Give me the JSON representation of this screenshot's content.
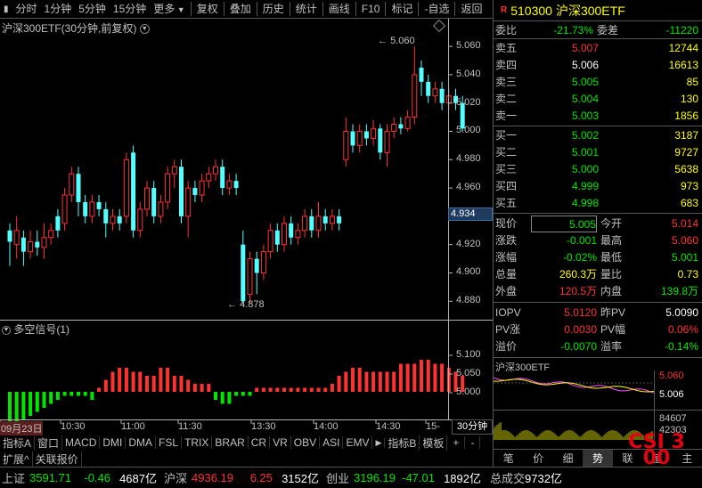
{
  "toolbar": {
    "items": [
      "分时",
      "1分钟",
      "5分钟",
      "15分钟",
      "更多",
      "复权",
      "叠加",
      "历史",
      "统计",
      "画线",
      "F10",
      "标记",
      "-自选",
      "返回"
    ]
  },
  "chart": {
    "title": "沪深300ETF(30分钟,前复权)",
    "current_price_tag": "4.934",
    "high_label": "5.060",
    "low_label": "4.878",
    "yticks": [
      "5.060",
      "5.040",
      "5.020",
      "5.000",
      "4.980",
      "4.960",
      "4.940",
      "4.920",
      "4.900",
      "4.880"
    ],
    "xticks": [
      "09月23日",
      "10:30",
      "11:00",
      "11:30",
      "13:30",
      "14:00",
      "14:30",
      "15-"
    ]
  },
  "indicator": {
    "title": "多空信号(1)",
    "yticks": [
      "5.100",
      "5.050",
      "5.000"
    ]
  },
  "chart_data": {
    "type": "candlestick",
    "candles": [
      {
        "o": 4.93,
        "c": 4.922,
        "h": 4.935,
        "l": 4.905
      },
      {
        "o": 4.92,
        "c": 4.93,
        "h": 4.94,
        "l": 4.91
      },
      {
        "o": 4.925,
        "c": 4.915,
        "h": 4.93,
        "l": 4.905
      },
      {
        "o": 4.915,
        "c": 4.922,
        "h": 4.93,
        "l": 4.91
      },
      {
        "o": 4.922,
        "c": 4.918,
        "h": 4.93,
        "l": 4.912
      },
      {
        "o": 4.918,
        "c": 4.925,
        "h": 4.935,
        "l": 4.91
      },
      {
        "o": 4.925,
        "c": 4.93,
        "h": 4.935,
        "l": 4.92
      },
      {
        "o": 4.94,
        "c": 4.93,
        "h": 4.945,
        "l": 4.925
      },
      {
        "o": 4.935,
        "c": 4.955,
        "h": 4.96,
        "l": 4.93
      },
      {
        "o": 4.955,
        "c": 4.97,
        "h": 4.975,
        "l": 4.95
      },
      {
        "o": 4.97,
        "c": 4.95,
        "h": 4.975,
        "l": 4.94
      },
      {
        "o": 4.95,
        "c": 4.94,
        "h": 4.955,
        "l": 4.935
      },
      {
        "o": 4.94,
        "c": 4.95,
        "h": 4.955,
        "l": 4.935
      },
      {
        "o": 4.95,
        "c": 4.945,
        "h": 4.955,
        "l": 4.94
      },
      {
        "o": 4.945,
        "c": 4.935,
        "h": 4.95,
        "l": 4.925
      },
      {
        "o": 4.935,
        "c": 4.94,
        "h": 4.945,
        "l": 4.93
      },
      {
        "o": 4.94,
        "c": 4.935,
        "h": 4.945,
        "l": 4.93
      },
      {
        "o": 4.94,
        "c": 4.98,
        "h": 4.985,
        "l": 4.935
      },
      {
        "o": 4.985,
        "c": 4.93,
        "h": 4.99,
        "l": 4.925
      },
      {
        "o": 4.93,
        "c": 4.945,
        "h": 4.95,
        "l": 4.925
      },
      {
        "o": 4.945,
        "c": 4.96,
        "h": 4.965,
        "l": 4.94
      },
      {
        "o": 4.96,
        "c": 4.94,
        "h": 4.965,
        "l": 4.935
      },
      {
        "o": 4.94,
        "c": 4.95,
        "h": 4.955,
        "l": 4.935
      },
      {
        "o": 4.95,
        "c": 4.97,
        "h": 4.975,
        "l": 4.945
      },
      {
        "o": 4.97,
        "c": 4.975,
        "h": 4.98,
        "l": 4.96
      },
      {
        "o": 4.975,
        "c": 4.94,
        "h": 4.98,
        "l": 4.935
      },
      {
        "o": 4.94,
        "c": 4.96,
        "h": 4.965,
        "l": 4.925
      },
      {
        "o": 4.96,
        "c": 4.955,
        "h": 4.965,
        "l": 4.95
      },
      {
        "o": 4.955,
        "c": 4.965,
        "h": 4.97,
        "l": 4.95
      },
      {
        "o": 4.965,
        "c": 4.97,
        "h": 4.975,
        "l": 4.96
      },
      {
        "o": 4.97,
        "c": 4.975,
        "h": 4.98,
        "l": 4.965
      },
      {
        "o": 4.975,
        "c": 4.96,
        "h": 4.98,
        "l": 4.955
      },
      {
        "o": 4.96,
        "c": 4.965,
        "h": 4.97,
        "l": 4.955
      },
      {
        "o": 4.965,
        "c": 4.96,
        "h": 4.97,
        "l": 4.955
      },
      {
        "o": 4.92,
        "c": 4.88,
        "h": 4.93,
        "l": 4.878
      },
      {
        "o": 4.885,
        "c": 4.91,
        "h": 4.915,
        "l": 4.878
      },
      {
        "o": 4.91,
        "c": 4.9,
        "h": 4.915,
        "l": 4.885
      },
      {
        "o": 4.9,
        "c": 4.915,
        "h": 4.92,
        "l": 4.895
      },
      {
        "o": 4.915,
        "c": 4.93,
        "h": 4.935,
        "l": 4.91
      },
      {
        "o": 4.93,
        "c": 4.92,
        "h": 4.935,
        "l": 4.915
      },
      {
        "o": 4.92,
        "c": 4.935,
        "h": 4.94,
        "l": 4.915
      },
      {
        "o": 4.935,
        "c": 4.925,
        "h": 4.94,
        "l": 4.92
      },
      {
        "o": 4.925,
        "c": 4.93,
        "h": 4.935,
        "l": 4.92
      },
      {
        "o": 4.93,
        "c": 4.94,
        "h": 4.945,
        "l": 4.925
      },
      {
        "o": 4.94,
        "c": 4.93,
        "h": 4.945,
        "l": 4.925
      },
      {
        "o": 4.93,
        "c": 4.94,
        "h": 4.95,
        "l": 4.925
      },
      {
        "o": 4.94,
        "c": 4.935,
        "h": 4.945,
        "l": 4.93
      },
      {
        "o": 4.935,
        "c": 4.94,
        "h": 4.945,
        "l": 4.93
      },
      {
        "o": 4.94,
        "c": 4.935,
        "h": 4.945,
        "l": 4.93
      },
      {
        "o": 4.98,
        "c": 5.0,
        "h": 5.01,
        "l": 4.975
      },
      {
        "o": 5.0,
        "c": 4.99,
        "h": 5.005,
        "l": 4.985
      },
      {
        "o": 4.99,
        "c": 5.0,
        "h": 5.005,
        "l": 4.985
      },
      {
        "o": 5.0,
        "c": 4.995,
        "h": 5.005,
        "l": 4.99
      },
      {
        "o": 4.995,
        "c": 5.002,
        "h": 5.008,
        "l": 4.99
      },
      {
        "o": 5.002,
        "c": 4.985,
        "h": 5.005,
        "l": 4.98
      },
      {
        "o": 4.985,
        "c": 5.0,
        "h": 5.005,
        "l": 4.975
      },
      {
        "o": 5.0,
        "c": 5.005,
        "h": 5.01,
        "l": 4.995
      },
      {
        "o": 5.005,
        "c": 5.002,
        "h": 5.01,
        "l": 4.998
      },
      {
        "o": 5.002,
        "c": 5.01,
        "h": 5.015,
        "l": 5.0
      },
      {
        "o": 5.01,
        "c": 5.04,
        "h": 5.06,
        "l": 5.005
      },
      {
        "o": 5.045,
        "c": 5.035,
        "h": 5.05,
        "l": 5.025
      },
      {
        "o": 5.035,
        "c": 5.025,
        "h": 5.04,
        "l": 5.02
      },
      {
        "o": 5.025,
        "c": 5.03,
        "h": 5.035,
        "l": 5.02
      },
      {
        "o": 5.03,
        "c": 5.02,
        "h": 5.035,
        "l": 5.015
      },
      {
        "o": 5.02,
        "c": 5.025,
        "h": 5.03,
        "l": 5.015
      },
      {
        "o": 5.025,
        "c": 5.02,
        "h": 5.03,
        "l": 5.015
      },
      {
        "o": 5.02,
        "c": 5.002,
        "h": 5.025,
        "l": 5.0
      }
    ],
    "signal": [
      -8,
      -8,
      -7,
      -6,
      -5,
      -4,
      -3,
      -2,
      -1,
      -1,
      -1,
      -1,
      -2,
      1,
      3,
      5,
      6,
      6,
      5,
      5,
      4,
      4,
      6,
      6,
      4,
      4,
      3,
      2,
      2,
      2,
      -2,
      -3,
      -3,
      -1,
      -1,
      -1,
      1,
      1,
      1,
      1,
      1,
      1,
      1,
      1,
      1,
      1,
      1,
      2,
      4,
      5,
      6,
      6,
      5,
      5,
      5,
      5,
      5,
      7,
      7,
      7,
      8,
      8,
      7,
      7,
      6,
      5,
      4
    ]
  },
  "tabs": [
    "指标A",
    "窗口",
    "MACD",
    "DMI",
    "DMA",
    "FSL",
    "TRIX",
    "BRAR",
    "CR",
    "VR",
    "OBV",
    "ASI",
    "EMV",
    "指标B",
    "模板",
    "+",
    "-",
    "30分钟"
  ],
  "tabs2": [
    "扩展^",
    "关联报价"
  ],
  "quote": {
    "code": "510300",
    "name": "沪深300ETF",
    "wb_label": "委比",
    "wb": "-21.73%",
    "wc_label": "委差",
    "wc": "-11220",
    "sells": [
      {
        "label": "卖五",
        "price": "5.007",
        "vol": "12744"
      },
      {
        "label": "卖四",
        "price": "5.006",
        "vol": "16613"
      },
      {
        "label": "卖三",
        "price": "5.005",
        "vol": "85"
      },
      {
        "label": "卖二",
        "price": "5.004",
        "vol": "130"
      },
      {
        "label": "卖一",
        "price": "5.003",
        "vol": "1856"
      }
    ],
    "buys": [
      {
        "label": "买一",
        "price": "5.002",
        "vol": "3187"
      },
      {
        "label": "买二",
        "price": "5.001",
        "vol": "9727"
      },
      {
        "label": "买三",
        "price": "5.000",
        "vol": "5638"
      },
      {
        "label": "买四",
        "price": "4.999",
        "vol": "973"
      },
      {
        "label": "买五",
        "price": "4.998",
        "vol": "683"
      }
    ],
    "stats": [
      {
        "l1": "现价",
        "v1": "5.005",
        "l2": "今开",
        "v2": "5.014"
      },
      {
        "l1": "涨跌",
        "v1": "-0.001",
        "l2": "最高",
        "v2": "5.060"
      },
      {
        "l1": "涨幅",
        "v1": "-0.02%",
        "l2": "最低",
        "v2": "5.001"
      },
      {
        "l1": "总量",
        "v1": "260.3万",
        "l2": "量比",
        "v2": "0.73"
      },
      {
        "l1": "外盘",
        "v1": "120.5万",
        "l2": "内盘",
        "v2": "139.8万"
      }
    ],
    "iopv": [
      {
        "l1": "IOPV",
        "v1": "5.0120",
        "l2": "昨PV",
        "v2": "5.0090"
      },
      {
        "l1": "PV涨",
        "v1": "0.0030",
        "l2": "PV幅",
        "v2": "0.06%"
      },
      {
        "l1": "溢价",
        "v1": "-0.0070",
        "l2": "溢率",
        "v2": "-0.14%"
      }
    ],
    "mini_title": "沪深300ETF",
    "mini_y1": "5.060",
    "mini_y2": "5.006",
    "mini_v1": "84607",
    "mini_v2": "42303",
    "bottom_tabs": [
      "笔",
      "价",
      "细",
      "势",
      "联",
      "值",
      "主"
    ],
    "logo": "CSI 300"
  },
  "status": {
    "items": [
      {
        "name": "上证",
        "val": "3591.71",
        "chg": "-0.46",
        "amt": "4687亿"
      },
      {
        "name": "沪深",
        "val": "4936.19",
        "chg": "6.25",
        "amt": "3152亿"
      },
      {
        "name": "创业",
        "val": "3196.19",
        "chg": "-47.01",
        "amt": "1892亿"
      }
    ],
    "total_label": "总成交",
    "total_val": "9732亿"
  }
}
